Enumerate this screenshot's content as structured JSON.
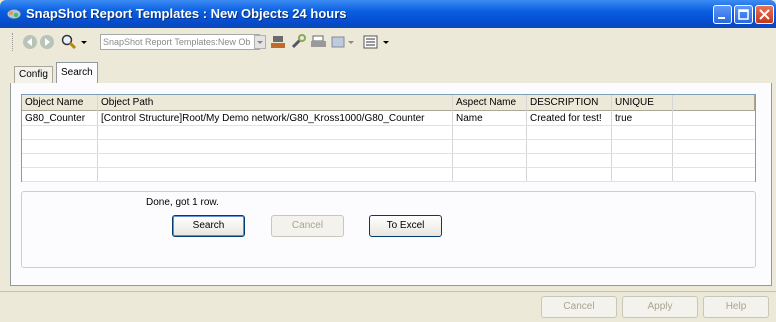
{
  "window": {
    "title": "SnapShot Report Templates : New Objects 24 hours",
    "controls": [
      "minimize-icon",
      "maximize-icon",
      "close-icon"
    ]
  },
  "toolbar": {
    "address_value": "SnapShot Report Templates:New Ob",
    "icons": [
      "back-icon",
      "forward-icon",
      "search-icon",
      "dropdown-icon",
      "network-icon",
      "tools-icon",
      "print-icon",
      "view-icon",
      "dropdown-icon",
      "list-icon",
      "dropdown-icon"
    ]
  },
  "tabs": [
    {
      "label": "Config",
      "active": false
    },
    {
      "label": "Search",
      "active": true
    }
  ],
  "table": {
    "columns": [
      "Object Name",
      "Object Path",
      "Aspect Name",
      "DESCRIPTION",
      "UNIQUE"
    ],
    "rows": [
      [
        "G80_Counter",
        "[Control Structure]Root/My Demo network/G80_Kross1000/G80_Counter",
        "Name",
        "Created for test!",
        "true"
      ]
    ]
  },
  "search_panel": {
    "status": "Done, got 1 row.",
    "search_label": "Search",
    "cancel_label": "Cancel",
    "excel_label": "To Excel"
  },
  "footer": {
    "cancel_label": "Cancel",
    "apply_label": "Apply",
    "help_label": "Help"
  },
  "colors": {
    "titlebar": "#0a5fe0",
    "window_bg": "#ece9d8",
    "grid_border": "#7f9db9"
  }
}
